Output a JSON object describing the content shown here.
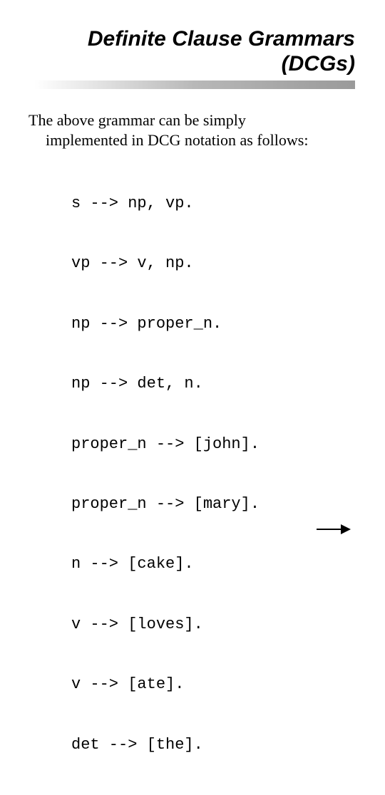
{
  "title": {
    "line1": "Definite Clause Grammars",
    "line2": "(DCGs)"
  },
  "intro": {
    "line1": "The above grammar can be simply",
    "line2": "implemented in DCG notation as follows:"
  },
  "code": [
    "s --> np, vp.",
    "vp --> v, np.",
    "np --> proper_n.",
    "np --> det, n.",
    "proper_n --> [john].",
    "proper_n --> [mary].",
    "n --> [cake].",
    "v --> [loves].",
    "v --> [ate].",
    "det --> [the]."
  ]
}
